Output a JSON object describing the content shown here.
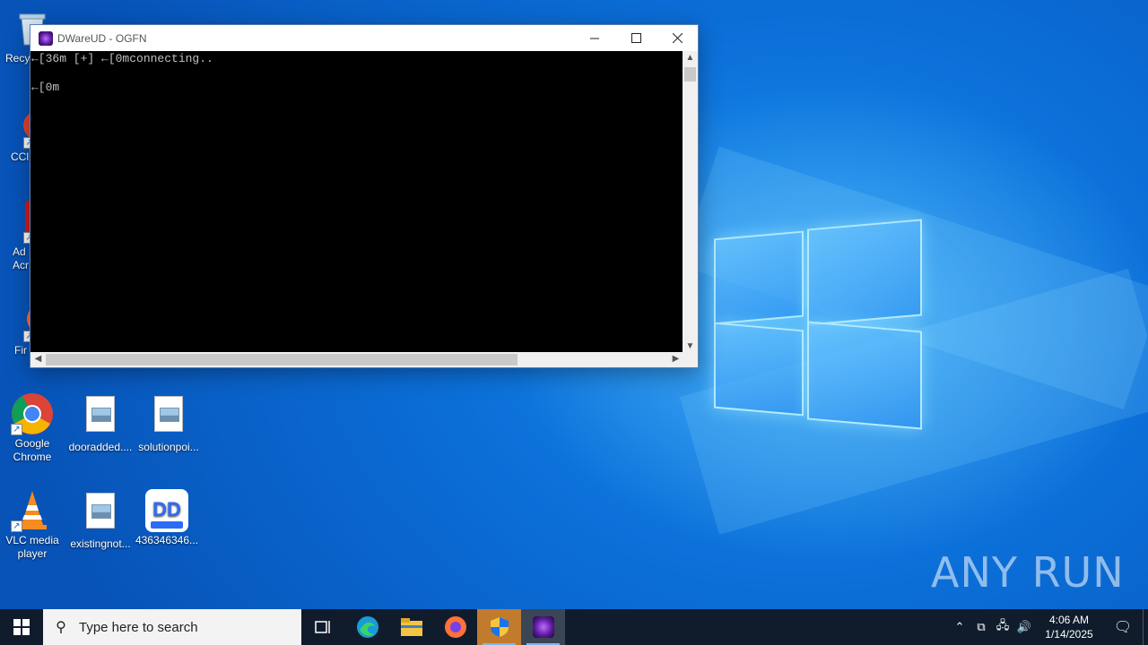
{
  "window": {
    "title": "DWareUD - OGFN",
    "console_lines": [
      "←[36m [+] ←[0mconnecting..",
      "",
      "←[0m"
    ]
  },
  "desktop_icons": [
    {
      "label": "Recycle Bin",
      "visible_label": "Recy"
    },
    {
      "label": "CCleaner",
      "visible_label": "CCl"
    },
    {
      "label": "Adobe Acrobat",
      "visible_label": "Ad Acr"
    },
    {
      "label": "Firefox",
      "visible_label": "Fir"
    },
    {
      "label": "Google Chrome"
    },
    {
      "label": "dooradded...."
    },
    {
      "label": "solutionpoi..."
    },
    {
      "label": "VLC media player"
    },
    {
      "label": "existingnot..."
    },
    {
      "label": "436346346..."
    }
  ],
  "taskbar": {
    "search_placeholder": "Type here to search",
    "clock_time": "4:06 AM",
    "clock_date": "1/14/2025"
  },
  "watermark": "ANY RUN",
  "colors": {
    "taskbar": "#101c2c",
    "console_bg": "#000000",
    "console_text": "#c0c0c0"
  }
}
